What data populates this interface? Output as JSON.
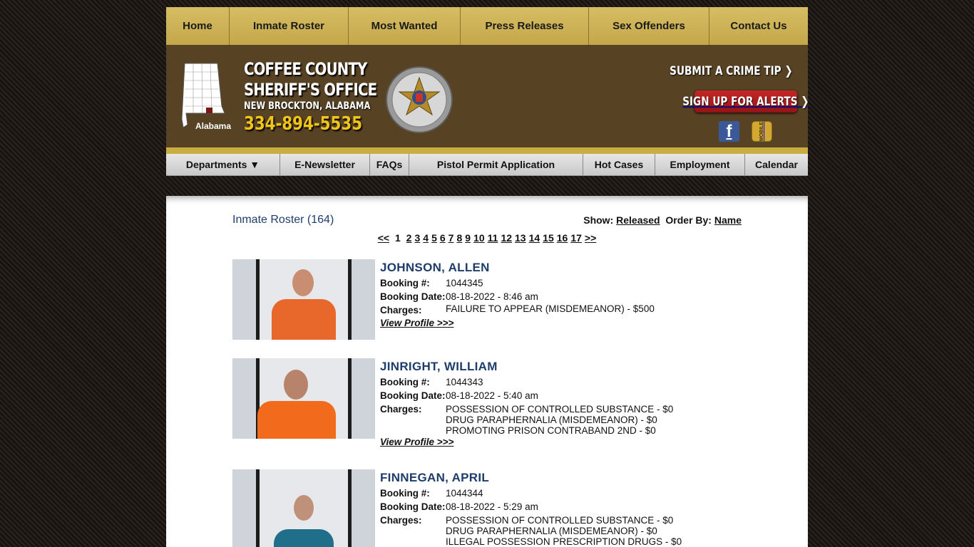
{
  "topnav": [
    "Home",
    "Inmate Roster",
    "Most Wanted",
    "Press Releases",
    "Sex Offenders",
    "Contact Us"
  ],
  "header": {
    "state_label": "Alabama",
    "brand_line1": "COFFEE COUNTY",
    "brand_line2": "SHERIFF'S OFFICE",
    "brand_sub": "NEW BROCKTON, ALABAMA",
    "phone": "334-894-5535",
    "crime_tip": "SUBMIT A CRIME TIP",
    "alerts": "SIGN UP FOR ALERTS",
    "facebook_icon": "facebook-icon",
    "mobile_icon": "mobile-icon",
    "mobile_label": "MOBILE"
  },
  "subnav": [
    "Departments ▼",
    "E-Newsletter",
    "FAQs",
    "Pistol Permit Application",
    "Hot Cases",
    "Employment",
    "Calendar"
  ],
  "roster": {
    "title": "Inmate Roster (164)",
    "show_label": "Show:",
    "show_value": "Released",
    "order_label": "Order By:",
    "order_value": "Name",
    "pager_prev": "<<",
    "pager_current": "1",
    "pager_pages": [
      "2",
      "3",
      "4",
      "5",
      "6",
      "7",
      "8",
      "9",
      "10",
      "11",
      "12",
      "13",
      "14",
      "15",
      "16",
      "17"
    ],
    "pager_next": ">>"
  },
  "labels": {
    "booking": "Booking #:",
    "date": "Booking Date:",
    "charges": "Charges:",
    "view": "View Profile >>>"
  },
  "inmates": [
    {
      "name": "JOHNSON, ALLEN",
      "booking": "1044345",
      "date": "08-18-2022 - 8:46 am",
      "charges": [
        "FAILURE TO APPEAR (MISDEMEANOR) - $500"
      ],
      "shirt_color": "#e8672a"
    },
    {
      "name": "JINRIGHT, WILLIAM",
      "booking": "1044343",
      "date": "08-18-2022 - 5:40 am",
      "charges": [
        "POSSESSION OF CONTROLLED SUBSTANCE - $0",
        "DRUG PARAPHERNALIA (MISDEMEANOR) - $0",
        "PROMOTING PRISON CONTRABAND 2ND - $0"
      ],
      "shirt_color": "#f26b1d"
    },
    {
      "name": "FINNEGAN, APRIL",
      "booking": "1044344",
      "date": "08-18-2022 - 5:29 am",
      "charges": [
        "POSSESSION OF CONTROLLED SUBSTANCE - $0",
        "DRUG PARAPHERNALIA (MISDEMEANOR) - $0",
        "ILLEGAL POSSESSION PRESCRIPTION DRUGS - $0"
      ],
      "shirt_color": "#1f6f8b"
    }
  ]
}
